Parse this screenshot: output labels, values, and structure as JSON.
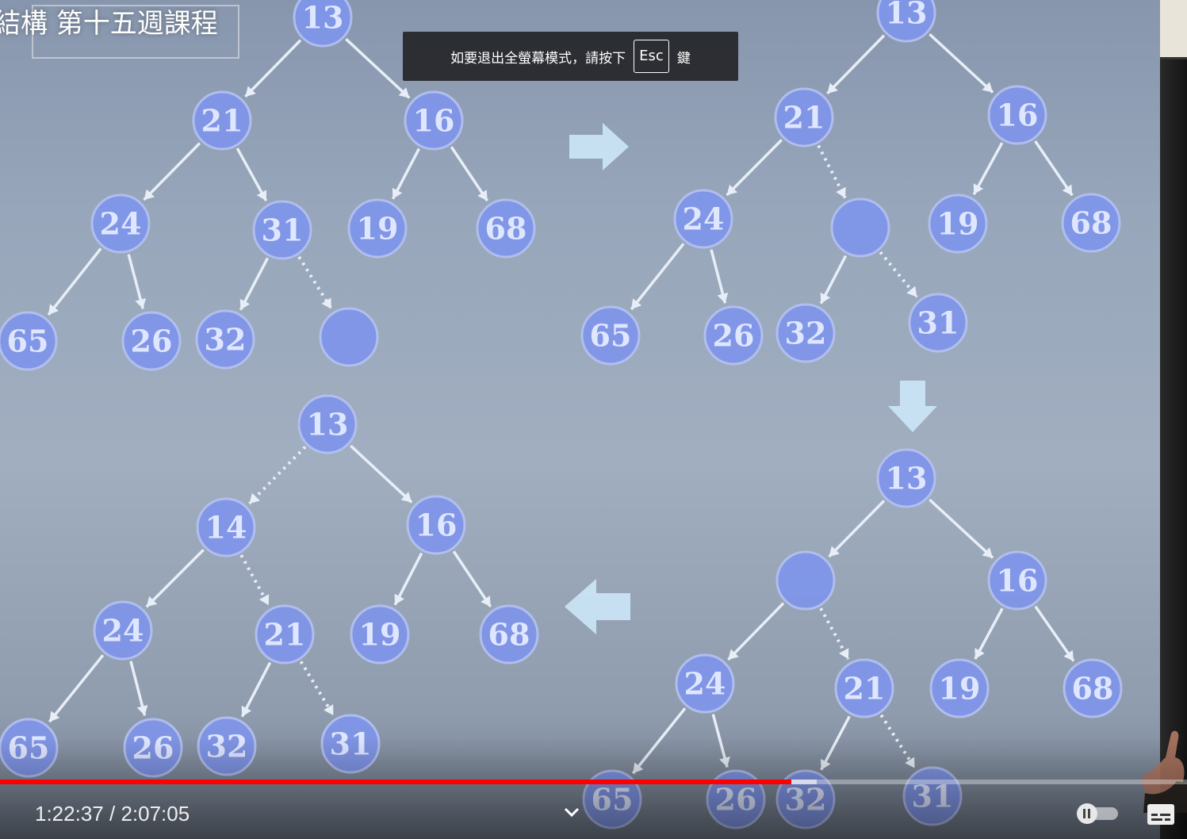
{
  "player": {
    "overlay_title": "結構 第十五週課程",
    "fullscreen_toast": {
      "prefix": "如要退出全螢幕模式，請按下",
      "key": "Esc",
      "suffix": "鍵"
    },
    "time": {
      "current": "1:22:37",
      "separator": "/",
      "duration": "2:07:05"
    },
    "progress": {
      "played_fraction": 0.667,
      "buffered_fraction": 0.688
    },
    "colors": {
      "progress_played": "#ff0000",
      "toast_background": "#1c1c1e"
    },
    "icons": [
      "volume-icon",
      "chevron-down-icon",
      "autoplay-toggle-icon",
      "subtitles-icon"
    ]
  },
  "slide": {
    "trees": [
      {
        "name": "tree-top-left",
        "nodes": [
          "13",
          "21",
          "16",
          "24",
          "31",
          "19",
          "68",
          "65",
          "26",
          "32",
          ""
        ]
      },
      {
        "name": "tree-top-right",
        "nodes": [
          "13",
          "21",
          "16",
          "24",
          "",
          "19",
          "68",
          "65",
          "26",
          "32",
          "31"
        ]
      },
      {
        "name": "tree-bottom-right",
        "nodes": [
          "13",
          "",
          "16",
          "24",
          "21",
          "19",
          "68",
          "65",
          "26",
          "32",
          "31"
        ]
      },
      {
        "name": "tree-bottom-left",
        "nodes": [
          "13",
          "14",
          "16",
          "24",
          "21",
          "19",
          "68",
          "65",
          "26",
          "32",
          "31"
        ]
      }
    ],
    "arrows": [
      "right",
      "down",
      "left"
    ]
  }
}
